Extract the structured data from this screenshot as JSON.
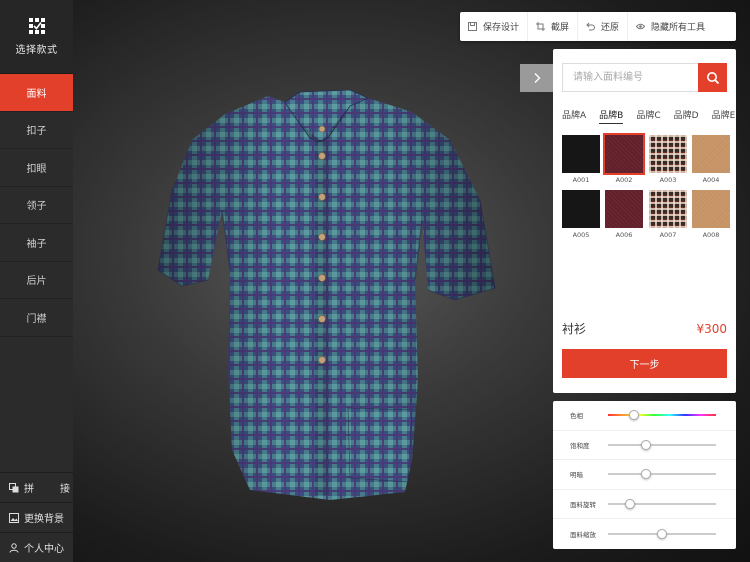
{
  "sidebar": {
    "logo_label": "选择款式",
    "items": [
      {
        "label": "面料",
        "active": true
      },
      {
        "label": "扣子",
        "active": false
      },
      {
        "label": "扣眼",
        "active": false
      },
      {
        "label": "领子",
        "active": false
      },
      {
        "label": "袖子",
        "active": false
      },
      {
        "label": "后片",
        "active": false
      },
      {
        "label": "门襟",
        "active": false
      }
    ],
    "bottom": {
      "splice_a": "拼",
      "splice_b": "接",
      "background": "更换背景",
      "user_center": "个人中心"
    }
  },
  "toolbar": {
    "save": "保存设计",
    "screenshot": "截屏",
    "restore": "还原",
    "hide_tools": "隐藏所有工具"
  },
  "fabric": {
    "search_placeholder": "请输入面料编号",
    "brands": [
      "品牌A",
      "品牌B",
      "品牌C",
      "品牌D",
      "品牌E"
    ],
    "active_brand": "品牌B",
    "swatches": [
      {
        "code": "A001",
        "style": "black",
        "selected": false
      },
      {
        "code": "A002",
        "style": "wine",
        "selected": true
      },
      {
        "code": "A003",
        "style": "check",
        "selected": false
      },
      {
        "code": "A004",
        "style": "tan",
        "selected": false
      },
      {
        "code": "A005",
        "style": "black",
        "selected": false
      },
      {
        "code": "A006",
        "style": "wine",
        "selected": false
      },
      {
        "code": "A007",
        "style": "check",
        "selected": false
      },
      {
        "code": "A008",
        "style": "tan",
        "selected": false
      }
    ]
  },
  "product": {
    "name": "衬衫",
    "price": "¥300",
    "next_label": "下一步"
  },
  "adjust": [
    {
      "label": "色相",
      "value": 0.24,
      "hue": true
    },
    {
      "label": "饱和度",
      "value": 0.35,
      "hue": false
    },
    {
      "label": "明暗",
      "value": 0.35,
      "hue": false
    },
    {
      "label": "面料旋转",
      "value": 0.2,
      "hue": false
    },
    {
      "label": "面料缩放",
      "value": 0.5,
      "hue": false
    }
  ],
  "colors": {
    "accent": "#e2402b",
    "sidebar": "#2b2b2b",
    "shirt_base": "#3b4f80",
    "shirt_teal": "#4f8d93",
    "shirt_purple": "#4a3a78",
    "button": "#c2a27a"
  }
}
